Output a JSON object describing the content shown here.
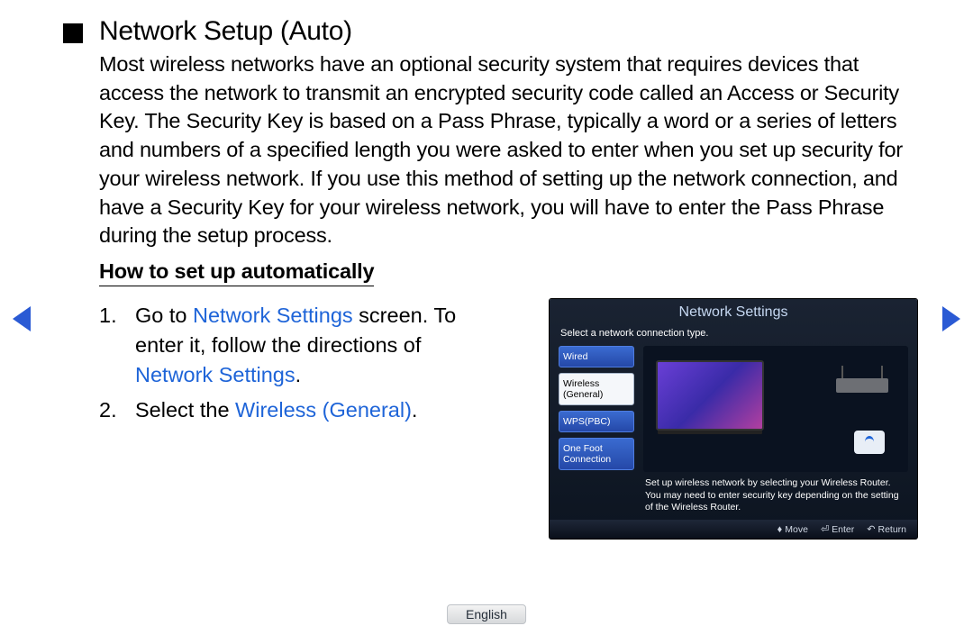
{
  "heading": "Network Setup (Auto)",
  "intro": "Most wireless networks have an optional security system that requires devices that access the network to transmit an encrypted security code called an Access or Security Key. The Security Key is based on a Pass Phrase, typically a word or a series of letters and numbers of a specified length you were asked to enter when you set up security for your wireless network. If you use this method of setting up the network connection, and have a Security Key for your wireless network, you will have to enter the Pass Phrase during the setup process.",
  "subheading": "How to set up automatically",
  "steps": {
    "s1": {
      "num": "1.",
      "pre": "Go to ",
      "term1": "Network Settings",
      "mid": " screen. To enter it, follow the directions of ",
      "term2": "Network Settings",
      "post": "."
    },
    "s2": {
      "num": "2.",
      "pre": "Select the ",
      "term": "Wireless (General)",
      "post": "."
    }
  },
  "tv": {
    "title": "Network Settings",
    "subtitle": "Select a network connection type.",
    "options": {
      "wired": "Wired",
      "wireless": "Wireless (General)",
      "wps": "WPS(PBC)",
      "onefoot": "One Foot Connection"
    },
    "desc": "Set up wireless network by selecting your Wireless Router. You may need to enter security key depending on the setting of the Wireless Router.",
    "footer": {
      "move": "Move",
      "enter": "Enter",
      "return": "Return"
    }
  },
  "language": "English"
}
